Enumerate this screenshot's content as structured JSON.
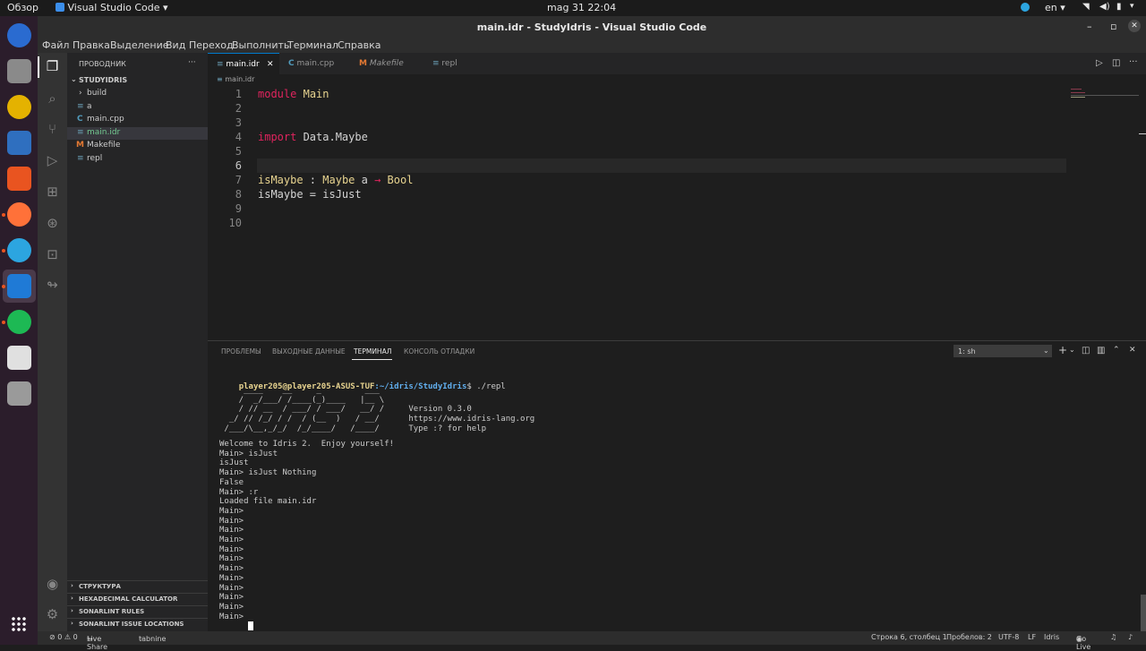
{
  "topbar": {
    "overview": "Обзор",
    "app_menu": "Visual Studio Code ▾",
    "datetime": "mag 31  22:04",
    "lang": "en ▾"
  },
  "window": {
    "title": "main.idr - StudyIdris - Visual Studio Code",
    "minimize": "–",
    "maximize": "▫",
    "close": "✕"
  },
  "menu": [
    "Файл",
    "Правка",
    "Выделение",
    "Вид",
    "Переход",
    "Выполнить",
    "Терминал",
    "Справка"
  ],
  "explorer": {
    "title": "ПРОВОДНИК",
    "more": "···",
    "project": "STUDYIDRIS",
    "items": [
      {
        "label": "build",
        "icon": "›"
      },
      {
        "label": "a",
        "icon": "≡"
      },
      {
        "label": "main.cpp",
        "icon": "C"
      },
      {
        "label": "main.idr",
        "icon": "≡"
      },
      {
        "label": "Makefile",
        "icon": "M"
      },
      {
        "label": "repl",
        "icon": "≡"
      }
    ],
    "bottom_sections": [
      "СТРУКТУРА",
      "HEXADECIMAL CALCULATOR",
      "SONARLINT RULES",
      "SONARLINT ISSUE LOCATIONS"
    ]
  },
  "tabs": [
    {
      "label": "main.idr",
      "icon": "≡"
    },
    {
      "label": "main.cpp",
      "icon": "C"
    },
    {
      "label": "Makefile",
      "icon": "M"
    },
    {
      "label": "repl",
      "icon": "≡"
    }
  ],
  "tab_close": "✕",
  "breadcrumb": "main.idr",
  "editor": {
    "lines": [
      {
        "n": "1",
        "parts": [
          [
            "kw",
            "module"
          ],
          [
            "pl",
            " "
          ],
          [
            "ty",
            "Main"
          ]
        ]
      },
      {
        "n": "2",
        "parts": []
      },
      {
        "n": "3",
        "parts": []
      },
      {
        "n": "4",
        "parts": [
          [
            "kw",
            "import"
          ],
          [
            "pl",
            " Data.Maybe"
          ]
        ]
      },
      {
        "n": "5",
        "parts": []
      },
      {
        "n": "6",
        "parts": []
      },
      {
        "n": "7",
        "parts": [
          [
            "fn",
            "isMaybe"
          ],
          [
            "pl",
            " : "
          ],
          [
            "ty",
            "Maybe"
          ],
          [
            "pl",
            " a "
          ],
          [
            "kw",
            "→"
          ],
          [
            "pl",
            " "
          ],
          [
            "ty",
            "Bool"
          ]
        ]
      },
      {
        "n": "8",
        "parts": [
          [
            "pl",
            "isMaybe = isJust"
          ]
        ]
      },
      {
        "n": "9",
        "parts": []
      },
      {
        "n": "10",
        "parts": []
      }
    ],
    "current_line": 6
  },
  "panel": {
    "tabs": [
      "ПРОБЛЕМЫ",
      "ВЫХОДНЫЕ ДАННЫЕ",
      "ТЕРМИНАЛ",
      "КОНСОЛЬ ОТЛАДКИ"
    ],
    "active_tab": 2,
    "terminal_select": "1: sh",
    "prompt_user": "player205@player205-ASUS-TUF",
    "prompt_path": ":~/idris/StudyIdris",
    "prompt_cmd": "$ ./repl",
    "banner": [
      "     ____    __     _         ___",
      "    /  _/___/ /____(_)____   |__ \\",
      "    / // __  / ___/ / ___/   __/ /     Version 0.3.0",
      "  _/ // /_/ / /  / (__  )   / __/      https://www.idris-lang.org",
      " /___/\\__,_/_/  /_/____/   /____/      Type :? for help"
    ],
    "output": [
      "Welcome to Idris 2.  Enjoy yourself!",
      "Main> isJust",
      "isJust",
      "Main> isJust Nothing",
      "False",
      "Main> :r",
      "Loaded file main.idr",
      "Main>",
      "Main>",
      "Main>",
      "Main>",
      "Main>",
      "Main>",
      "Main>",
      "Main>",
      "Main>",
      "Main>",
      "Main>",
      "Main>"
    ]
  },
  "status": {
    "errors": "⊘ 0 ⚠ 0",
    "live_share": "Live Share",
    "tabnine": "tabnine",
    "position": "Строка 6, столбец 1",
    "indent": "Пробелов: 2",
    "encoding": "UTF-8",
    "eol": "LF",
    "language": "Idris",
    "go_live": "Go Live"
  },
  "colors": {
    "accent": "#007acc",
    "keyword": "#e0245e",
    "type": "#e7d38f",
    "prompt_user": "#e7d38f",
    "prompt_path": "#61afef"
  }
}
